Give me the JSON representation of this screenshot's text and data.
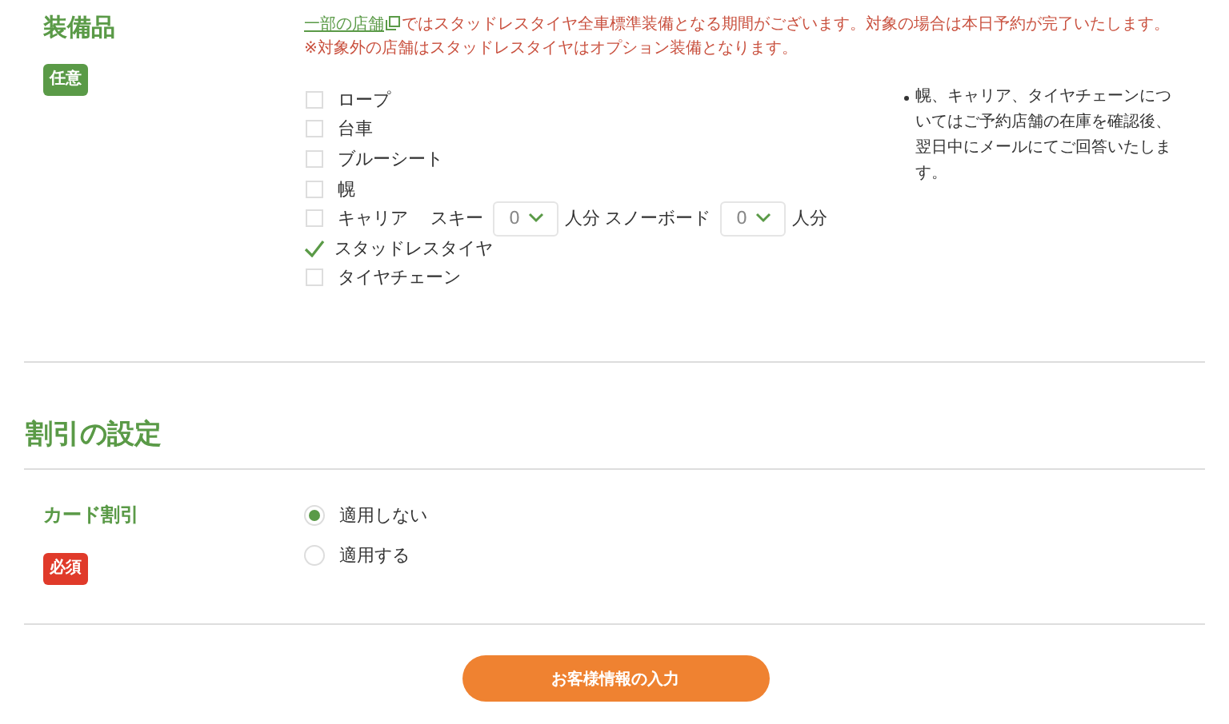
{
  "equipment": {
    "label": "装備品",
    "badge": {
      "text": "任意",
      "required": false
    },
    "notice": {
      "link": "一部の店舗",
      "text": "ではスタッドレスタイヤ全車標準装備となる期間がございます。対象の場合は本日予約が完了いたします。",
      "note": "※対象外の店舗はスタッドレスタイヤはオプション装備となります。"
    },
    "options": [
      {
        "kind": "check",
        "label": "ロープ",
        "checked": false
      },
      {
        "kind": "check",
        "label": "台車",
        "checked": false
      },
      {
        "kind": "check",
        "label": "ブルーシート",
        "checked": false
      },
      {
        "kind": "check",
        "label": "幌",
        "checked": false
      },
      {
        "kind": "carrier",
        "label": "キャリア",
        "checked": false,
        "counts": [
          {
            "label": "スキー",
            "value": "0",
            "unit": "人分"
          },
          {
            "label": "スノーボード",
            "value": "0",
            "unit": "人分"
          }
        ]
      },
      {
        "kind": "check",
        "label": "スタッドレスタイヤ",
        "checked": true
      },
      {
        "kind": "check",
        "label": "タイヤチェーン",
        "checked": false
      }
    ],
    "side_note": "幌、キャリア、タイヤチェーンについてはご予約店舗の在庫を確認後、翌日中にメールにてご回答いたします。"
  },
  "discount": {
    "heading": "割引の設定",
    "field": {
      "label": "カード割引",
      "badge": {
        "text": "必須",
        "required": true
      },
      "options": [
        {
          "label": "適用しない",
          "selected": true
        },
        {
          "label": "適用する",
          "selected": false
        }
      ]
    }
  },
  "submit": {
    "label": "お客様情報の入力"
  }
}
